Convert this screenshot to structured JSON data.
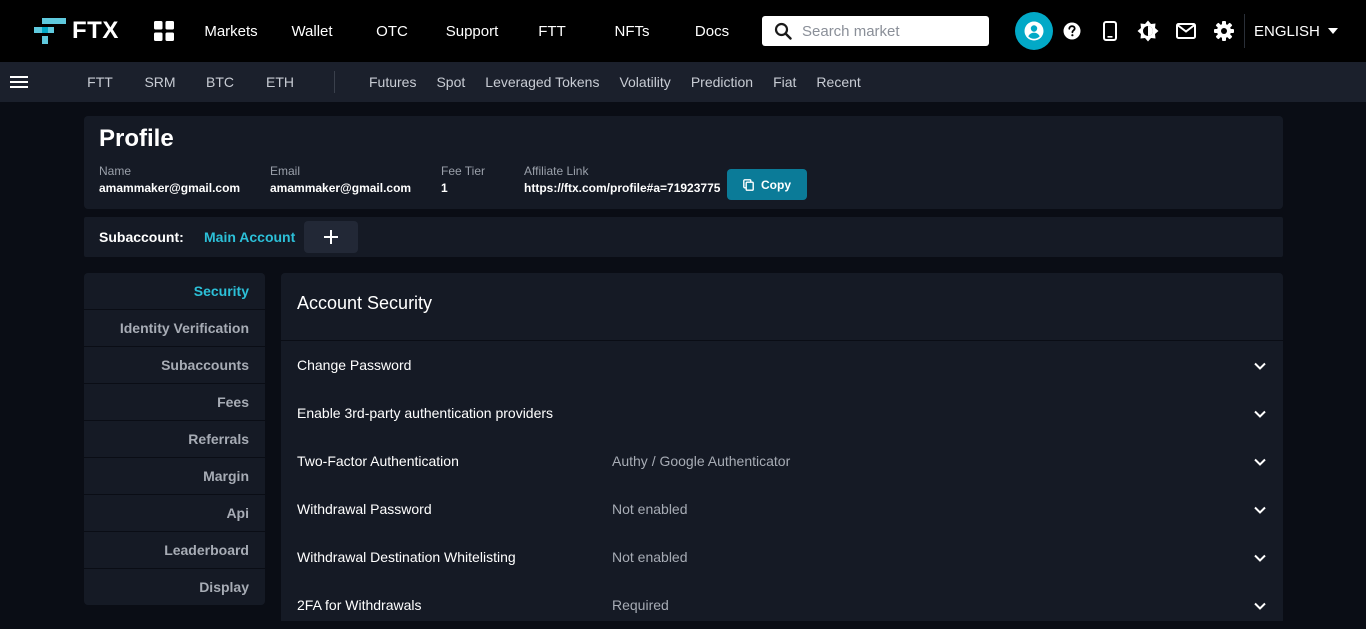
{
  "brand": {
    "name": "FTX"
  },
  "topnav": [
    "Markets",
    "Wallet",
    "OTC",
    "Support",
    "FTT",
    "NFTs",
    "Docs"
  ],
  "search": {
    "placeholder": "Search market",
    "value": ""
  },
  "language": "ENGLISH",
  "subnav": {
    "coins": [
      "FTT",
      "SRM",
      "BTC",
      "ETH"
    ],
    "categories": [
      "Futures",
      "Spot",
      "Leveraged Tokens",
      "Volatility",
      "Prediction",
      "Fiat",
      "Recent"
    ]
  },
  "profile": {
    "title": "Profile",
    "name_label": "Name",
    "name_value": "amammaker@gmail.com",
    "email_label": "Email",
    "email_value": "amammaker@gmail.com",
    "fee_label": "Fee Tier",
    "fee_value": "1",
    "affiliate_label": "Affiliate Link",
    "affiliate_value": "https://ftx.com/profile#a=71923775",
    "copy_label": "Copy"
  },
  "subaccount": {
    "label": "Subaccount:",
    "current": "Main Account",
    "add_symbol": "+"
  },
  "sidemenu": [
    "Security",
    "Identity Verification",
    "Subaccounts",
    "Fees",
    "Referrals",
    "Margin",
    "Api",
    "Leaderboard",
    "Display"
  ],
  "security": {
    "title": "Account Security",
    "rows": [
      {
        "name": "Change Password",
        "status": ""
      },
      {
        "name": "Enable 3rd-party authentication providers",
        "status": ""
      },
      {
        "name": "Two-Factor Authentication",
        "status": "Authy / Google Authenticator"
      },
      {
        "name": "Withdrawal Password",
        "status": "Not enabled"
      },
      {
        "name": "Withdrawal Destination Whitelisting",
        "status": "Not enabled"
      },
      {
        "name": "2FA for Withdrawals",
        "status": "Required"
      }
    ]
  },
  "colors": {
    "accent": "#02a9c7",
    "link": "#2cc0d8",
    "copy_button": "#0b7b98",
    "topbar": "#000000",
    "panel": "#151a25"
  },
  "icons": [
    "ftx-logo-icon",
    "apps-grid-icon",
    "search-icon",
    "account-icon",
    "help-icon",
    "mobile-icon",
    "theme-icon",
    "mail-icon",
    "gear-icon",
    "caret-down-icon",
    "menu-icon",
    "copy-icon",
    "plus-icon",
    "chevron-down-icon"
  ]
}
